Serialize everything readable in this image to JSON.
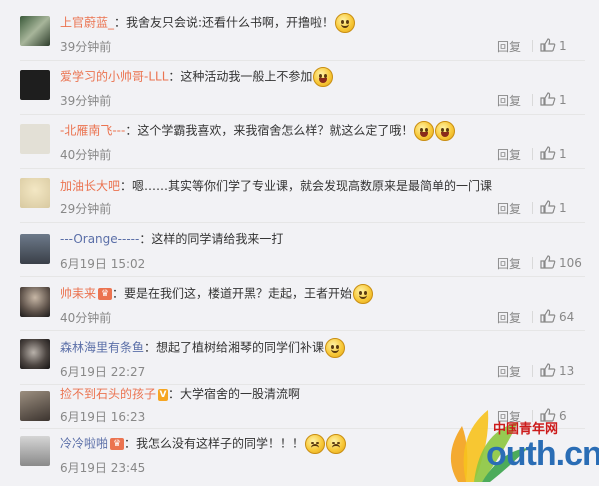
{
  "comments": [
    {
      "name": "上官蔚蓝_",
      "text": "：我舍友只会说:还看什么书啊，开撸啦！",
      "time": "39分钟前",
      "reply": "回复",
      "likes": "1",
      "name_color": "#eb7350",
      "emoji": [
        "smile-emoji"
      ]
    },
    {
      "name": "爱学习的小帅哥-LLL",
      "text": "：这种活动我一般上不参加",
      "time": "39分钟前",
      "reply": "回复",
      "likes": "1",
      "name_color": "#eb7350",
      "emoji": [
        "laugh-emoji"
      ]
    },
    {
      "name": "-北雁南飞---",
      "text": "：这个学霸我喜欢，来我宿舍怎么样？就这么定了哦！",
      "time": "40分钟前",
      "reply": "回复",
      "likes": "1",
      "name_color": "#eb7350",
      "emoji": [
        "laugh-emoji",
        "laugh-emoji"
      ]
    },
    {
      "name": "加油长大吧",
      "text": "：嗯……其实等你们学了专业课，就会发现高数原来是最简单的一门课",
      "time": "29分钟前",
      "reply": "回复",
      "likes": "1",
      "name_color": "#eb7350",
      "emoji": []
    },
    {
      "name": "---Orange-----",
      "text": "：这样的同学请给我来一打",
      "time": "6月19日 15:02",
      "reply": "回复",
      "likes": "106",
      "name_color": "#5b6fa8",
      "emoji": []
    },
    {
      "name": "帅耒来",
      "text": "：要是在我们这，楼道开黑？走起，王者开始",
      "time": "40分钟前",
      "reply": "回复",
      "likes": "64",
      "name_color": "#eb7350",
      "emoji": [
        "smile-emoji"
      ]
    },
    {
      "name": "森林海里有条鱼",
      "text": "：想起了植树给湘琴的同学们补课",
      "time": "6月19日 22:27",
      "reply": "回复",
      "likes": "13",
      "name_color": "#5b6fa8",
      "emoji": [
        "smile-emoji"
      ]
    },
    {
      "name": "捡不到石头的孩子",
      "text": "：大学宿舍的一股清流啊",
      "time": "6月19日 16:23",
      "reply": "回复",
      "likes": "6",
      "name_color": "#eb7350",
      "emoji": []
    },
    {
      "name": "冷冷啦啪",
      "text": "：我怎么没有这样子的同学！！！",
      "time": "6月19日 23:45",
      "reply": "回复",
      "likes": "",
      "name_color": "#5b6fa8",
      "emoji": [
        "angry-emoji",
        "angry-emoji"
      ]
    }
  ],
  "watermark": {
    "cn": "中国青年网",
    "en": "outh.cn"
  }
}
